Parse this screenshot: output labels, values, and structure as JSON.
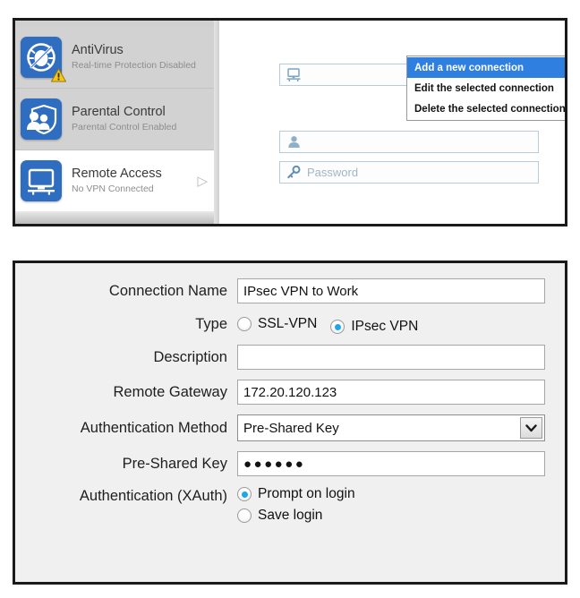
{
  "top_panel": {
    "sidebar": {
      "items": [
        {
          "icon": "antivirus-shield-bug-icon",
          "title": "AntiVirus",
          "status": "Real-time Protection Disabled",
          "selected": false,
          "warning": true,
          "arrow": ""
        },
        {
          "icon": "parental-control-family-shield-icon",
          "title": "Parental Control",
          "status": "Parental Control Enabled",
          "selected": false,
          "warning": false,
          "arrow": ""
        },
        {
          "icon": "remote-access-monitor-icon",
          "title": "Remote Access",
          "status": "No VPN Connected",
          "selected": true,
          "warning": false,
          "arrow": "▷"
        }
      ]
    },
    "connection": {
      "combo_icon": "network-computer-icon",
      "combo_value": "",
      "combo_placeholder": "",
      "dropdown_arrow_icon": "chevron-down-icon",
      "gear_icon": "gear-icon",
      "gear_caret_icon": "chevron-down-small-icon"
    },
    "username": {
      "icon": "user-icon",
      "value": "",
      "placeholder": ""
    },
    "password": {
      "icon": "key-icon",
      "value": "",
      "placeholder": "Password"
    },
    "context_menu": {
      "items": [
        {
          "label": "Add a new connection",
          "highlighted": true
        },
        {
          "label": "Edit the selected connection",
          "highlighted": false
        },
        {
          "label": "Delete the selected connection",
          "highlighted": false
        }
      ]
    }
  },
  "bottom_panel": {
    "fields": {
      "connection_name_label": "Connection Name",
      "connection_name_value": "IPsec VPN to Work",
      "type_label": "Type",
      "type_options": [
        {
          "label": "SSL-VPN",
          "selected": false
        },
        {
          "label": "IPsec VPN",
          "selected": true
        }
      ],
      "description_label": "Description",
      "description_value": "",
      "remote_gateway_label": "Remote Gateway",
      "remote_gateway_value": "172.20.120.123",
      "auth_method_label": "Authentication Method",
      "auth_method_value": "Pre-Shared Key",
      "auth_method_caret_icon": "chevron-down-icon",
      "psk_label": "Pre-Shared Key",
      "psk_value": "●●●●●●",
      "xauth_label": "Authentication (XAuth)",
      "xauth_options": [
        {
          "label": "Prompt on login",
          "selected": true
        },
        {
          "label": "Save login",
          "selected": false
        }
      ]
    }
  },
  "colors": {
    "icon_blue": "#2f6dc0",
    "menu_highlight": "#2f7fe0",
    "radio_dot": "#1ea7e8",
    "field_border_blue": "#b6ccde",
    "panel_border": "#1a1a1a",
    "sidebar_bg": "#d2d2d2"
  }
}
